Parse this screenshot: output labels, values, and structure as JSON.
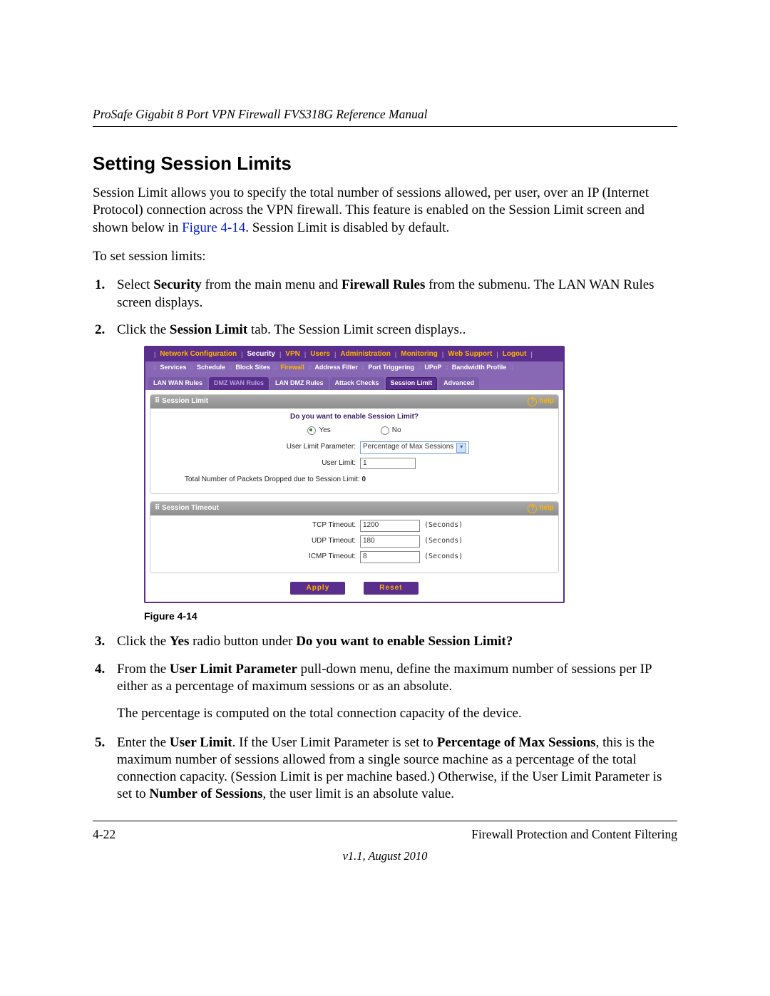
{
  "header": {
    "running_head": "ProSafe Gigabit 8 Port VPN Firewall FVS318G Reference Manual"
  },
  "section": {
    "title": "Setting Session Limits"
  },
  "para_intro_a": "Session Limit allows you to specify the total number of sessions allowed, per user, over an IP (Internet Protocol) connection across the VPN firewall. This feature is enabled on the Session Limit screen and shown below in ",
  "para_intro_link": "Figure 4-14",
  "para_intro_b": ". Session Limit is disabled by default.",
  "para_toset": "To set session limits:",
  "steps": {
    "s1a": "Select ",
    "s1b": "Security",
    "s1c": " from the main menu and ",
    "s1d": "Firewall Rules",
    "s1e": " from the submenu. The LAN WAN Rules screen displays.",
    "s2a": "Click the ",
    "s2b": "Session Limit",
    "s2c": " tab. The Session Limit screen displays..",
    "s3a": "Click the ",
    "s3b": "Yes",
    "s3c": " radio button under ",
    "s3d": "Do you want to enable Session Limit?",
    "s4a": "From the ",
    "s4b": "User Limit Parameter",
    "s4c": " pull-down menu, define the maximum number of sessions per IP either as a percentage of maximum sessions or as an absolute.",
    "s4_extra": "The percentage is computed on the total connection capacity of the device.",
    "s5a": "Enter the ",
    "s5b": "User Limit",
    "s5c": ". If the User Limit Parameter is set to ",
    "s5d": "Percentage of Max Sessions",
    "s5e": ", this is the maximum number of sessions allowed from a single source machine as a percentage of the total connection capacity. (Session Limit is per machine based.) Otherwise, if the User Limit Parameter is set to ",
    "s5f": "Number of Sessions",
    "s5g": ", the user limit is an absolute value."
  },
  "ui": {
    "topnav": [
      "Network Configuration",
      "Security",
      "VPN",
      "Users",
      "Administration",
      "Monitoring",
      "Web Support",
      "Logout"
    ],
    "topnav_active": "Security",
    "subnav": [
      "Services",
      "Schedule",
      "Block Sites",
      "Firewall",
      "Address Filter",
      "Port Triggering",
      "UPnP",
      "Bandwidth Profile"
    ],
    "subnav_active": "Firewall",
    "tabs": [
      "LAN WAN Rules",
      "DMZ WAN Rules",
      "LAN DMZ Rules",
      "Attack Checks",
      "Session Limit",
      "Advanced"
    ],
    "tab_active": "Session Limit",
    "panel1": {
      "title": "Session Limit",
      "help": "help",
      "question": "Do you want to enable Session Limit?",
      "yes": "Yes",
      "no": "No",
      "ulp_label": "User Limit Parameter:",
      "ulp_value": "Percentage of Max Sessions",
      "ul_label": "User Limit:",
      "ul_value": "1",
      "dropped_label": "Total Number of Packets Dropped due to Session Limit: ",
      "dropped_value": "0"
    },
    "panel2": {
      "title": "Session Timeout",
      "help": "help",
      "tcp_label": "TCP Timeout:",
      "tcp_value": "1200",
      "udp_label": "UDP Timeout:",
      "udp_value": "180",
      "icmp_label": "ICMP Timeout:",
      "icmp_value": "8",
      "unit": "(Seconds)"
    },
    "buttons": {
      "apply": "Apply",
      "reset": "Reset"
    }
  },
  "figure_caption": "Figure 4-14",
  "footer": {
    "page": "4-22",
    "chapter": "Firewall Protection and Content Filtering",
    "version": "v1.1, August 2010"
  }
}
